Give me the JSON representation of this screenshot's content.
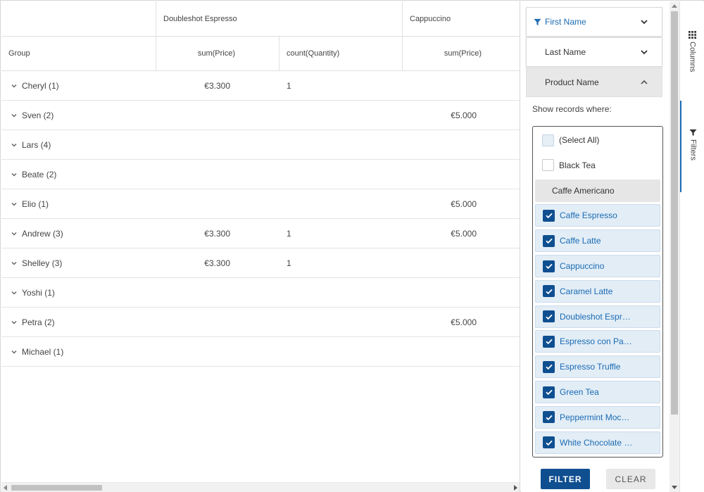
{
  "grid": {
    "header_groups": [
      "",
      "Doubleshot Espresso",
      "Cappuccino"
    ],
    "header_cols": [
      "Group",
      "sum(Price)",
      "count(Quantity)",
      "sum(Price)"
    ],
    "rows": [
      {
        "group": "Cheryl (1)",
        "c1": "€3.300",
        "c2": "1",
        "c3": ""
      },
      {
        "group": "Sven (2)",
        "c1": "",
        "c2": "",
        "c3": "€5.000"
      },
      {
        "group": "Lars (4)",
        "c1": "",
        "c2": "",
        "c3": ""
      },
      {
        "group": "Beate (2)",
        "c1": "",
        "c2": "",
        "c3": ""
      },
      {
        "group": "Elio (1)",
        "c1": "",
        "c2": "",
        "c3": "€5.000"
      },
      {
        "group": "Andrew (3)",
        "c1": "€3.300",
        "c2": "1",
        "c3": "€5.000"
      },
      {
        "group": "Shelley (3)",
        "c1": "€3.300",
        "c2": "1",
        "c3": ""
      },
      {
        "group": "Yoshi (1)",
        "c1": "",
        "c2": "",
        "c3": ""
      },
      {
        "group": "Petra (2)",
        "c1": "",
        "c2": "",
        "c3": "€5.000"
      },
      {
        "group": "Michael (1)",
        "c1": "",
        "c2": "",
        "c3": ""
      }
    ]
  },
  "filters": {
    "accordions": [
      {
        "label": "First Name",
        "filtered": true,
        "expanded": false
      },
      {
        "label": "Last Name",
        "filtered": false,
        "expanded": false
      },
      {
        "label": "Product Name",
        "filtered": false,
        "expanded": true
      }
    ],
    "show_where": "Show records where:",
    "options": [
      {
        "label": "(Select All)",
        "state": "indeterminate"
      },
      {
        "label": "Black Tea",
        "state": "unchecked"
      },
      {
        "label": "Caffe Americano",
        "state": "hover"
      },
      {
        "label": "Caffe Espresso",
        "state": "checked"
      },
      {
        "label": "Caffe Latte",
        "state": "checked"
      },
      {
        "label": "Cappuccino",
        "state": "checked"
      },
      {
        "label": "Caramel Latte",
        "state": "checked"
      },
      {
        "label": "Doubleshot Espr…",
        "state": "checked"
      },
      {
        "label": "Espresso con Pa…",
        "state": "checked"
      },
      {
        "label": "Espresso Truffle",
        "state": "checked"
      },
      {
        "label": "Green Tea",
        "state": "checked"
      },
      {
        "label": "Peppermint Moc…",
        "state": "checked"
      },
      {
        "label": "White Chocolate …",
        "state": "checked"
      }
    ],
    "filter_button": "FILTER",
    "clear_button": "CLEAR"
  },
  "side_tabs": {
    "columns": "Columns",
    "filters": "Filters"
  },
  "colors": {
    "accent": "#1b6bb3",
    "button": "#0f4f90",
    "checked_bg": "#e2edf6"
  }
}
